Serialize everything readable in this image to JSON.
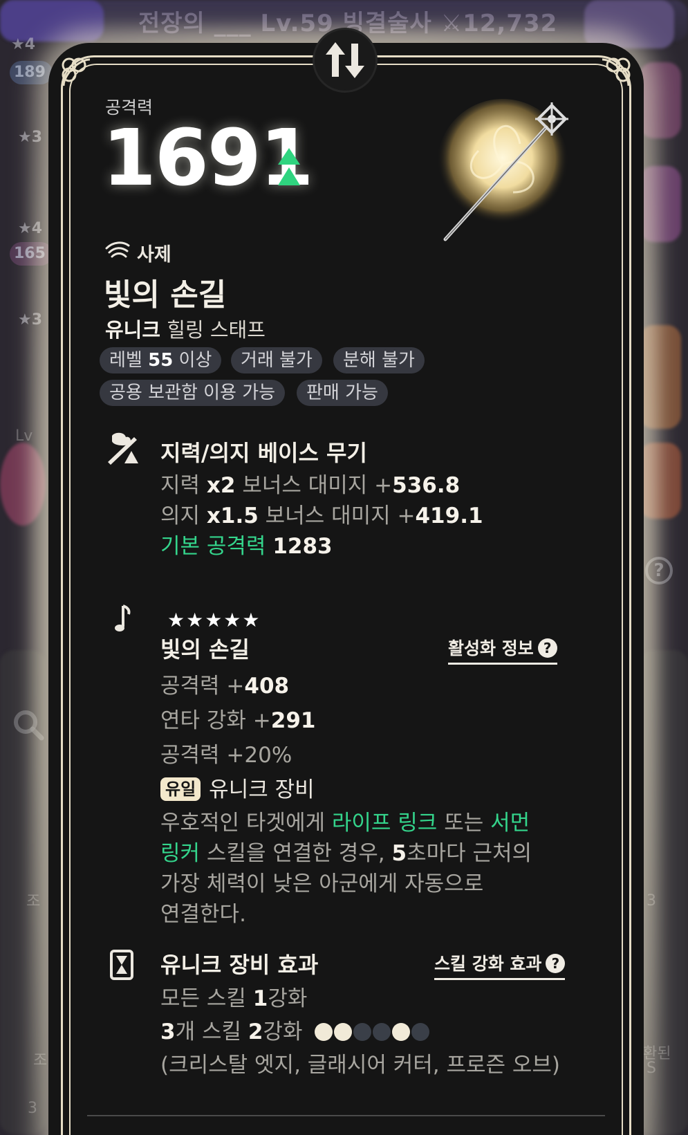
{
  "background": {
    "header_text": "전장의 ___ Lv.59 빙결술사 ⚔12,732",
    "stars": [
      "★4",
      "★3",
      "★4",
      "★3"
    ],
    "pills": [
      "189",
      "165"
    ],
    "side_labels": [
      "Lv",
      "조",
      "조",
      "3",
      "환된",
      "S",
      "3"
    ]
  },
  "card": {
    "swap_icon": "swap-vertical-icon",
    "stat": {
      "label": "공격력",
      "value": "1691",
      "change_icon": "double-up-arrow-icon",
      "change_color": "#2fd47f"
    },
    "item": {
      "class_icon": "priest-wing-icon",
      "class_name": "사제",
      "name": "빛의 손길",
      "grade": "유니크",
      "type": "힐링 스태프"
    },
    "tags": [
      {
        "pre": "레벨 ",
        "bold": "55",
        "post": " 이상"
      },
      {
        "pre": "거래 불가",
        "bold": "",
        "post": ""
      },
      {
        "pre": "분해 불가",
        "bold": "",
        "post": ""
      },
      {
        "pre": "공용 보관함 이용 가능",
        "bold": "",
        "post": ""
      },
      {
        "pre": "판매 가능",
        "bold": "",
        "post": ""
      }
    ],
    "base": {
      "icon": "brain-weapon-icon",
      "title": "지력/의지 베이스 무기",
      "line1": {
        "stat": "지력 ",
        "mult": "x2",
        "mid": " 보너스 대미지 +",
        "value": "536.8"
      },
      "line2": {
        "stat": "의지 ",
        "mult": "x1.5",
        "mid": " 보너스 대미지 +",
        "value": "419.1"
      },
      "line3": {
        "label": "기본 공격력 ",
        "value": "1283"
      }
    },
    "set": {
      "icon": "music-note-icon",
      "stars": "★★★★★",
      "title": "빛의 손길",
      "info_link": "활성화 정보",
      "line1": {
        "label": "공격력 +",
        "value": "408"
      },
      "line2": {
        "label": "연타 강화 +",
        "value": "291"
      },
      "line3": {
        "label": "공격력 +",
        "value": "20%"
      },
      "unique_badge": "유일",
      "unique_label": "유니크 장비",
      "desc": {
        "p1": "우호적인 타겟에게 ",
        "g1": "라이프 링크",
        "p2": " 또는 ",
        "g2": "서먼",
        "g3": "링커",
        "p3": " 스킬을 연결한 경우, ",
        "num": "5",
        "p4": "초마다 근처의",
        "p5": "가장 체력이 낮은 아군에게 자동으로",
        "p6": "연결한다."
      }
    },
    "effect": {
      "icon": "hourglass-card-icon",
      "title": "유니크 장비 효과",
      "skill_link": "스킬 강화 효과",
      "line1": {
        "pre": "모든 스킬 ",
        "num": "1",
        "post": "강화"
      },
      "line2": {
        "num1": "3",
        "mid": "개 스킬 ",
        "num2": "2",
        "post": "강화"
      },
      "dots": [
        true,
        true,
        false,
        false,
        true,
        false
      ],
      "skills": "(크리스탈 엣지, 글래시어 커터, 프로즌 오브)"
    }
  }
}
